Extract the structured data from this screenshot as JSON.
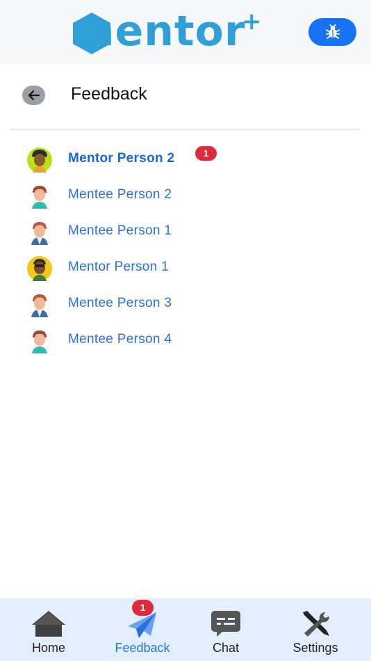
{
  "header": {
    "logo_text": "mentor",
    "logo_plus": "+",
    "bug_icon": "bug-icon"
  },
  "title_row": {
    "back_icon": "arrow-left-icon",
    "title": "Feedback"
  },
  "list": {
    "items": [
      {
        "name": "Mentor Person 2",
        "unread": "1",
        "bold": true,
        "avatar": "mentor-avatar-green"
      },
      {
        "name": "Mentee Person 2",
        "unread": null,
        "bold": false,
        "avatar": "mentee-avatar"
      },
      {
        "name": "Mentee Person 1",
        "unread": null,
        "bold": false,
        "avatar": "mentee-avatar-jacket"
      },
      {
        "name": "Mentor Person 1",
        "unread": null,
        "bold": false,
        "avatar": "mentor-avatar-yellow"
      },
      {
        "name": "Mentee Person 3",
        "unread": null,
        "bold": false,
        "avatar": "mentee-avatar-jacket"
      },
      {
        "name": "Mentee Person 4",
        "unread": null,
        "bold": false,
        "avatar": "mentee-avatar"
      }
    ]
  },
  "bottom_nav": {
    "items": [
      {
        "label": "Home",
        "icon": "home-icon",
        "active": false,
        "badge": null
      },
      {
        "label": "Feedback",
        "icon": "paper-plane-icon",
        "active": true,
        "badge": "1"
      },
      {
        "label": "Chat",
        "icon": "chat-icon",
        "active": false,
        "badge": null
      },
      {
        "label": "Settings",
        "icon": "tools-icon",
        "active": false,
        "badge": null
      }
    ]
  },
  "colors": {
    "brand": "#2f9fd7",
    "primary": "#1672f3",
    "link": "#2a6fe0",
    "badge": "#dd2b3c",
    "nav_bg": "#e3eefc"
  }
}
